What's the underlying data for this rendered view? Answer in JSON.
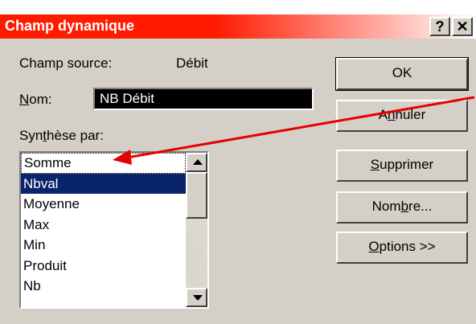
{
  "dialog": {
    "title": "Champ dynamique",
    "help_label": "?",
    "close_label": "✕"
  },
  "source": {
    "label": "Champ source:",
    "value": "Débit"
  },
  "name": {
    "label_mnemonic": "N",
    "label_rest": "om:",
    "value": "NB Débit"
  },
  "summary": {
    "label_pre": "Syn",
    "label_mnemonic": "t",
    "label_post": "hèse par:",
    "items": [
      "Somme",
      "Nbval",
      "Moyenne",
      "Max",
      "Min",
      "Produit",
      "Nb"
    ],
    "selected": "Nbval"
  },
  "buttons": {
    "ok": "OK",
    "cancel_pre": "A",
    "cancel_mnemonic": "n",
    "cancel_post": "nuler",
    "delete_mnemonic": "S",
    "delete_post": "upprimer",
    "number_pre": "Nom",
    "number_mnemonic": "b",
    "number_post": "re...",
    "options_mnemonic": "O",
    "options_post": "ptions >>"
  },
  "annotation": {
    "arrow_color": "#e60000"
  }
}
